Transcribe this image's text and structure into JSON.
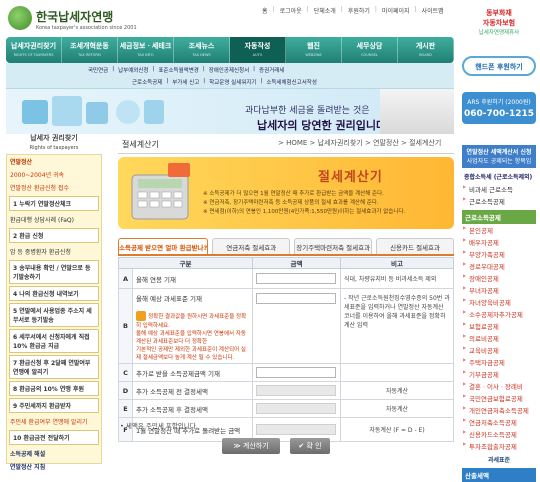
{
  "header": {
    "logo_text": "한국납세자연맹",
    "logo_sub": "Korea taxpayer's association since 2001",
    "top_links": [
      "홈",
      "로그아웃",
      "단체소개",
      "후원하기",
      "마이페이지",
      "사이트맵"
    ],
    "sponsor_line1": "동부화재",
    "sponsor_line2": "자동차보험",
    "sponsor_line3": "납세자연맹제휴사"
  },
  "nav": {
    "tabs": [
      {
        "label": "납세자권리찾기",
        "en": "RIGHTS OF TAXPAYERS"
      },
      {
        "label": "조세개혁운동",
        "en": "TAX REFORM"
      },
      {
        "label": "세금정보ㆍ세테크",
        "en": "TAX INFO"
      },
      {
        "label": "조세뉴스",
        "en": "TAX NEWS"
      },
      {
        "label": "자동작성",
        "en": "AUTO"
      },
      {
        "label": "웹진",
        "en": "WEBZINE"
      },
      {
        "label": "세무상담",
        "en": "COUNSEL"
      },
      {
        "label": "게시판",
        "en": "BOARD"
      }
    ],
    "active": 4
  },
  "subnav": {
    "row1": [
      "국민연금",
      "납부예외신청",
      "표준소득월액변경",
      "장애인공제신청서",
      "증권거래세"
    ],
    "row2": [
      "근로소득공제",
      "부가세 신고",
      "학교운영 실세워지기",
      "소득세체험신고서작성"
    ]
  },
  "banner": {
    "line1": "과다납부한 세금을 돌려받는 것은",
    "line2": "납세자의 당연한 권리입니다."
  },
  "right_sidebar": {
    "homepage_btn": "핸드폰 후원하기",
    "ars_title": "ARS 후원하기 (2000원)",
    "ars_number": "060-700-1215",
    "tax_box_title": "연말정산 세액계산서 신청",
    "tax_box_sub": "사업자도 공제되는 항목임",
    "list_head": "종합소득세 (근로소득제외)",
    "list1": [
      "비과세 근로소득",
      "근로소득공제"
    ],
    "sec1": "근로소득공제",
    "list2": [
      "본인공제",
      "배우자공제",
      "부양가족공제",
      "경로우대공제",
      "장애인공제",
      "부녀자공제",
      "자녀양육비공제",
      "소수공제자추가공제",
      "보험료공제",
      "의료비공제",
      "교육비공제",
      "주택자금공제",
      "기부금공제",
      "결혼ㆍ이사ㆍ장례비",
      "국민연금보험료공제",
      "개인연금저축소득공제",
      "연금저축소득공제",
      "신용카드소득공제",
      "투자조합출자공제"
    ],
    "ded_label": "과세표준",
    "sec2": "산출세액"
  },
  "left_sidebar": {
    "title": "납세자 권리찾기",
    "title_en": "Rights of taxpayers",
    "entries": [
      {
        "text": "연말정산",
        "style": "head"
      },
      {
        "text": "2000~2004년 귀속",
        "style": "red"
      },
      {
        "text": "연말정산 환급신청 접수",
        "style": "red"
      },
      {
        "text": "1 누락기 연말정산체크",
        "style": "sec"
      },
      {
        "text": "환급대행 상담사례 (FaQ)",
        "style": "normal"
      },
      {
        "text": "2 환급 신청",
        "style": "sec"
      },
      {
        "text": "암 등 중병환자 환급신청",
        "style": "normal"
      },
      {
        "text": "3 송부내용 확인 / 연말으로 등기발송하기",
        "style": "sec"
      },
      {
        "text": "4 나의 환급신청 내역보기",
        "style": "sec"
      },
      {
        "text": "5 연말에서 사용업종 주소지 세무서로 등기발송",
        "style": "sec"
      },
      {
        "text": "6 세무서에서 신청자에게 직접 10% 환급금 지급",
        "style": "sec"
      },
      {
        "text": "7 환급신청 후 2달째 연말여부 연맹에 알리기",
        "style": "sec"
      },
      {
        "text": "8 환급금의 10% 연맹 후원",
        "style": "sec"
      },
      {
        "text": "9 주민세까지 환급받자",
        "style": "sec"
      },
      {
        "text": "주민세 환급여부 연맹에 알리기",
        "style": "red"
      },
      {
        "text": "10 환급금전 전달하기",
        "style": "sec"
      },
      {
        "text": "소득공제 해설",
        "style": "blue"
      },
      {
        "text": "연말정산 지침",
        "style": "blue"
      }
    ]
  },
  "main": {
    "title": "절세계산기",
    "breadcrumb": "> HOME > 납세자권리찾기 > 연말정산 > 절세계산기",
    "calc_title": "절세계산기",
    "calc_lines": [
      "※ 소득공제가 더 많으면 1월 연말정산 때 추가로 환급받는 금액을 계산해 준다.",
      "※ 연금저축, 장기주택마련저축 등 소득공제 상품의 절세 효과를 계산해 준다.",
      "※ 면세점(이하)의 연봉인 1,100만원(4인가족:1,550만원)이하는 절세효과가 없습니다."
    ],
    "tabs": [
      "소득공제 받으면 얼마 환급받나?",
      "연금저축 절세효과",
      "장기주택마련저축 절세효과",
      "신용카드 절세효과"
    ],
    "active_tab": 0,
    "columns": [
      "구분",
      "금액",
      "비고"
    ],
    "rows": [
      {
        "label": "A",
        "name": "올해 연봉 기재",
        "amount": "",
        "note": "식대, 차량유지비 등 비과세소득 제외"
      },
      {
        "label": "B",
        "name": "올해 예상 과세표준 기재",
        "amount": "",
        "note": "- 작년 근로소득원천징수영수증의 50번 과세표준을 입력하거나 연말정산 자동계산 코너를 이용하여 올해 과세표준을 정확히 계산 입력"
      },
      {
        "label": "C",
        "name": "추가로 받을 소득공제금액 기재",
        "amount": "",
        "note": ""
      },
      {
        "label": "D",
        "name": "추가 소득공제 전 결정세액",
        "amount": "",
        "note": "자동계산"
      },
      {
        "label": "E",
        "name": "추가 소득공제 후 결정세액",
        "amount": "",
        "note": "자동계산"
      },
      {
        "label": "F",
        "name": "1월 연말정산 때 추가로 돌려받는 금액",
        "amount": "",
        "note": "자동계산 (F = D - E)"
      }
    ],
    "warn_line1": "정확한 결과값을 원하시면 과세표준을 정확히 입력하세요.",
    "warn_line2": "올해 예상 과세표준을 입력하시면 연봉에서 자동계산된 과세표준보다 더 정확한",
    "warn_line3": "기본적인 공제만 제외한 과세표준이 계산되어 실제 절세금액보다 높게 계산 될 수 있습니다.",
    "footnote": "• 세액은 주민세 포함입니다.",
    "calc_button": "≫ 계산하기",
    "ok_button": "✔ 확 인"
  }
}
